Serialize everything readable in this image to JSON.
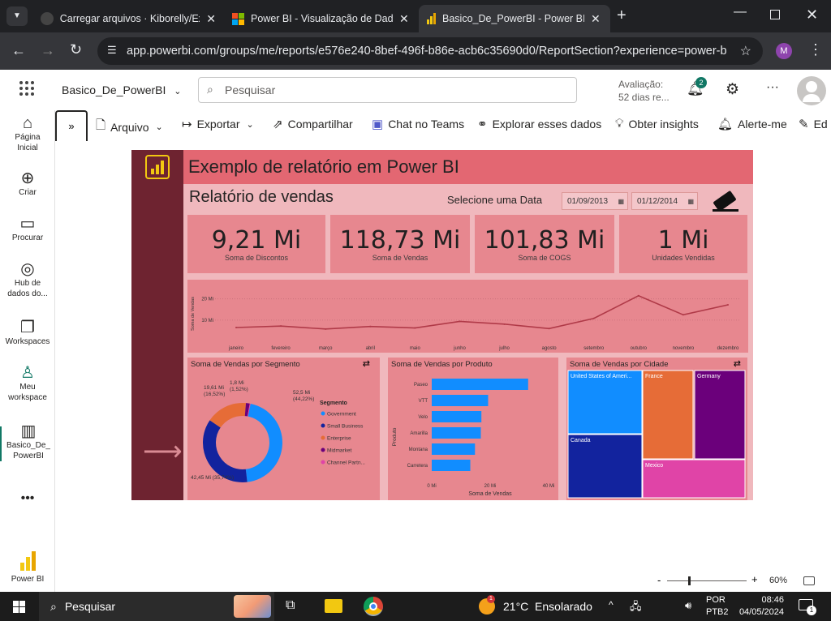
{
  "browser": {
    "tabs": [
      {
        "label": "Carregar arquivos · Kiborelly/Ex"
      },
      {
        "label": "Power BI - Visualização de Dado"
      },
      {
        "label": "Basico_De_PowerBI - Power BI"
      }
    ],
    "url": "app.powerbi.com/groups/me/reports/e576e240-8bef-496f-b86e-acb6c35690d0/ReportSection?experience=power-bi",
    "profile_initial": "M"
  },
  "header": {
    "report_name": "Basico_De_PowerBI",
    "search_placeholder": "Pesquisar",
    "trial_line1": "Avaliação:",
    "trial_line2": "52 dias re...",
    "notif_count": "2"
  },
  "nav": [
    {
      "label": "Página Inicial"
    },
    {
      "label": "Criar"
    },
    {
      "label": "Procurar"
    },
    {
      "label": "Hub de dados do..."
    },
    {
      "label": "Workspaces"
    },
    {
      "label": "Meu workspace"
    },
    {
      "label": "Basico_De_PowerBI"
    },
    {
      "label": "Power BI"
    }
  ],
  "toolbar": {
    "arquivo": "Arquivo",
    "exportar": "Exportar",
    "compartilhar": "Compartilhar",
    "teams": "Chat no Teams",
    "explorar": "Explorar esses dados",
    "insights": "Obter insights",
    "alerte": "Alerte-me",
    "edit": "Ed"
  },
  "report": {
    "title": "Exemplo de relatório em Power BI",
    "subtitle": "Relatório de vendas",
    "date_label": "Selecione uma Data",
    "date_from": "01/09/2013",
    "date_to": "01/12/2014",
    "kpis": [
      {
        "value": "9,21 Mi",
        "label": "Soma de Discontos"
      },
      {
        "value": "118,73 Mi",
        "label": "Soma de Vendas"
      },
      {
        "value": "101,83 Mi",
        "label": "Soma de COGS"
      },
      {
        "value": "1 Mi",
        "label": "Unidades Vendidas"
      }
    ],
    "donut_title": "Soma de Vendas por Segmento",
    "bar_title": "Soma de Vendas por Produto",
    "treemap_title": "Soma de Vendas por Cidade",
    "legend_title": "Segmento",
    "donut_labels": [
      "52,5 Mi (44,22%)",
      "42,45 Mi (35,74%)",
      "19,61 Mi (16,52%)",
      "1,8 Mi (1,52%)"
    ]
  },
  "chart_data": [
    {
      "type": "line",
      "ylabel": "Soma de Vendas",
      "y_ticks": [
        "10 Mi",
        "20 Mi"
      ],
      "ylim": [
        0,
        26
      ],
      "categories": [
        "janeiro",
        "fevereiro",
        "março",
        "abril",
        "maio",
        "junho",
        "julho",
        "agosto",
        "setembro",
        "outubro",
        "novembro",
        "dezembro"
      ],
      "values": [
        6.5,
        7.2,
        5.8,
        7.0,
        6.3,
        9.4,
        8.1,
        6.0,
        10.8,
        21.5,
        12.5,
        17.2
      ],
      "color": "#b03a48"
    },
    {
      "type": "pie",
      "title": "Soma de Vendas por Segmento",
      "legend_title": "Segmento",
      "slices": [
        {
          "name": "Government",
          "value": 52.5,
          "color": "#118dff"
        },
        {
          "name": "Small Business",
          "value": 42.45,
          "color": "#12239e"
        },
        {
          "name": "Enterprise",
          "value": 19.61,
          "color": "#e66c37"
        },
        {
          "name": "Midmarket",
          "value": 1.8,
          "color": "#6b007b"
        },
        {
          "name": "Channel Partn...",
          "value": 0.37,
          "color": "#e044a7"
        }
      ]
    },
    {
      "type": "bar",
      "title": "Soma de Vendas por Produto",
      "xlabel": "Soma de Vendas",
      "ylabel": "Produto",
      "x_ticks": [
        "0 Mi",
        "20 Mi",
        "40 Mi"
      ],
      "xlim": [
        0,
        40
      ],
      "categories": [
        "Paseo",
        "VTT",
        "Velo",
        "Amarilla",
        "Montana",
        "Carretera"
      ],
      "values": [
        33.0,
        19.3,
        17.0,
        16.8,
        14.8,
        13.2
      ],
      "color": "#118dff"
    },
    {
      "type": "treemap",
      "title": "Soma de Vendas por Cidade",
      "items": [
        {
          "name": "United States of Ameri...",
          "color": "#118dff"
        },
        {
          "name": "Canada",
          "color": "#12239e"
        },
        {
          "name": "France",
          "color": "#e66c37"
        },
        {
          "name": "Germany",
          "color": "#6b007b"
        },
        {
          "name": "Mexico",
          "color": "#e044a7"
        }
      ]
    }
  ],
  "status": {
    "zoom": "60%"
  },
  "taskbar": {
    "search": "Pesquisar",
    "weather": "21°C  Ensolarado",
    "lang1": "POR",
    "lang2": "PTB2",
    "time": "08:46",
    "date": "04/05/2024",
    "notif": "1"
  }
}
